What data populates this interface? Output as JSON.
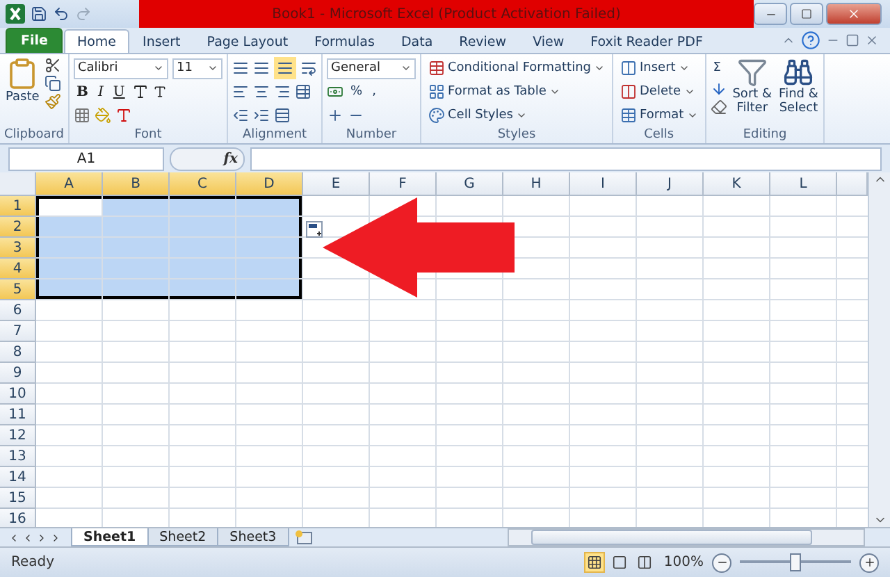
{
  "title_bar": {
    "title": "Book1  -  Microsoft Excel (Product Activation Failed)"
  },
  "ribbon_tabs": [
    {
      "label": "File",
      "selected": false,
      "kind": "file"
    },
    {
      "label": "Home",
      "selected": true,
      "kind": "tab"
    },
    {
      "label": "Insert",
      "selected": false,
      "kind": "tab"
    },
    {
      "label": "Page Layout",
      "selected": false,
      "kind": "tab"
    },
    {
      "label": "Formulas",
      "selected": false,
      "kind": "tab"
    },
    {
      "label": "Data",
      "selected": false,
      "kind": "tab"
    },
    {
      "label": "Review",
      "selected": false,
      "kind": "tab"
    },
    {
      "label": "View",
      "selected": false,
      "kind": "tab"
    },
    {
      "label": "Foxit Reader PDF",
      "selected": false,
      "kind": "tab"
    }
  ],
  "ribbon_groups": [
    {
      "kind": "clipboard",
      "name": "Clipboard",
      "texts": [
        "Paste"
      ]
    },
    {
      "kind": "font",
      "name": "Font",
      "texts": [
        "Calibri",
        "11",
        "B",
        "I",
        "U"
      ]
    },
    {
      "kind": "alignment",
      "name": "Alignment"
    },
    {
      "kind": "number",
      "name": "Number",
      "texts": [
        "General",
        "%",
        ","
      ]
    },
    {
      "kind": "styles",
      "name": "Styles",
      "texts": [
        "Conditional Formatting",
        "Format as Table",
        "Cell Styles"
      ]
    },
    {
      "kind": "cells",
      "name": "Cells",
      "texts": [
        "Insert",
        "Delete",
        "Format"
      ]
    },
    {
      "kind": "editing",
      "name": "Editing",
      "texts": [
        "Σ",
        "Sort &",
        "Filter",
        "Find &",
        "Select"
      ]
    }
  ],
  "formula_bar": {
    "name_box": "A1",
    "function_label": "fx"
  },
  "grid": {
    "columns": [
      {
        "label": "A",
        "selected": true
      },
      {
        "label": "B",
        "selected": true
      },
      {
        "label": "C",
        "selected": true
      },
      {
        "label": "D",
        "selected": true
      },
      {
        "label": "E",
        "selected": false
      },
      {
        "label": "F",
        "selected": false
      },
      {
        "label": "G",
        "selected": false
      },
      {
        "label": "H",
        "selected": false
      },
      {
        "label": "I",
        "selected": false
      },
      {
        "label": "J",
        "selected": false
      },
      {
        "label": "K",
        "selected": false
      },
      {
        "label": "L",
        "selected": false
      }
    ],
    "rows": [
      {
        "label": "1",
        "selected": true
      },
      {
        "label": "2",
        "selected": true
      },
      {
        "label": "3",
        "selected": true
      },
      {
        "label": "4",
        "selected": true
      },
      {
        "label": "5",
        "selected": true
      },
      {
        "label": "6",
        "selected": false
      },
      {
        "label": "7",
        "selected": false
      },
      {
        "label": "8",
        "selected": false
      },
      {
        "label": "9",
        "selected": false
      },
      {
        "label": "10",
        "selected": false
      },
      {
        "label": "11",
        "selected": false
      },
      {
        "label": "12",
        "selected": false
      },
      {
        "label": "13",
        "selected": false
      },
      {
        "label": "14",
        "selected": false
      },
      {
        "label": "15",
        "selected": false
      },
      {
        "label": "16",
        "selected": false
      }
    ]
  },
  "sheet_tabs": [
    {
      "label": "Sheet1",
      "selected": true
    },
    {
      "label": "Sheet2",
      "selected": false
    },
    {
      "label": "Sheet3",
      "selected": false
    }
  ],
  "status_bar": {
    "status": "Ready",
    "zoom": "100%",
    "zoom_level": {
      "level": 0.5
    }
  }
}
